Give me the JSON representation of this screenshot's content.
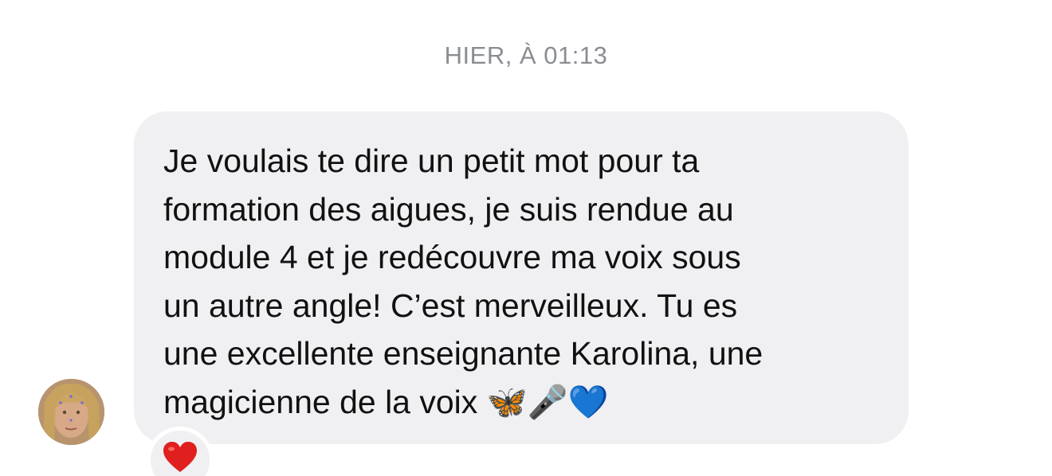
{
  "chat": {
    "timestamp": "HIER, À 01:13",
    "message": {
      "lines": [
        "Je voulais te dire un petit mot pour ta",
        "formation des aigues, je suis rendue au",
        "module 4 et je redécouvre ma voix sous",
        "un autre angle! C’est merveilleux. Tu es",
        "une excellente enseignante Karolina, une",
        "magicienne de la voix 🦋🎤💙"
      ]
    },
    "reaction": {
      "icon": "red-heart-icon",
      "color": "#e0201e"
    },
    "avatar": {
      "icon": "avatar-photo"
    },
    "colors": {
      "bubble": "#f0f0f2",
      "timestamp": "#8a8d93",
      "text": "#111111"
    }
  }
}
